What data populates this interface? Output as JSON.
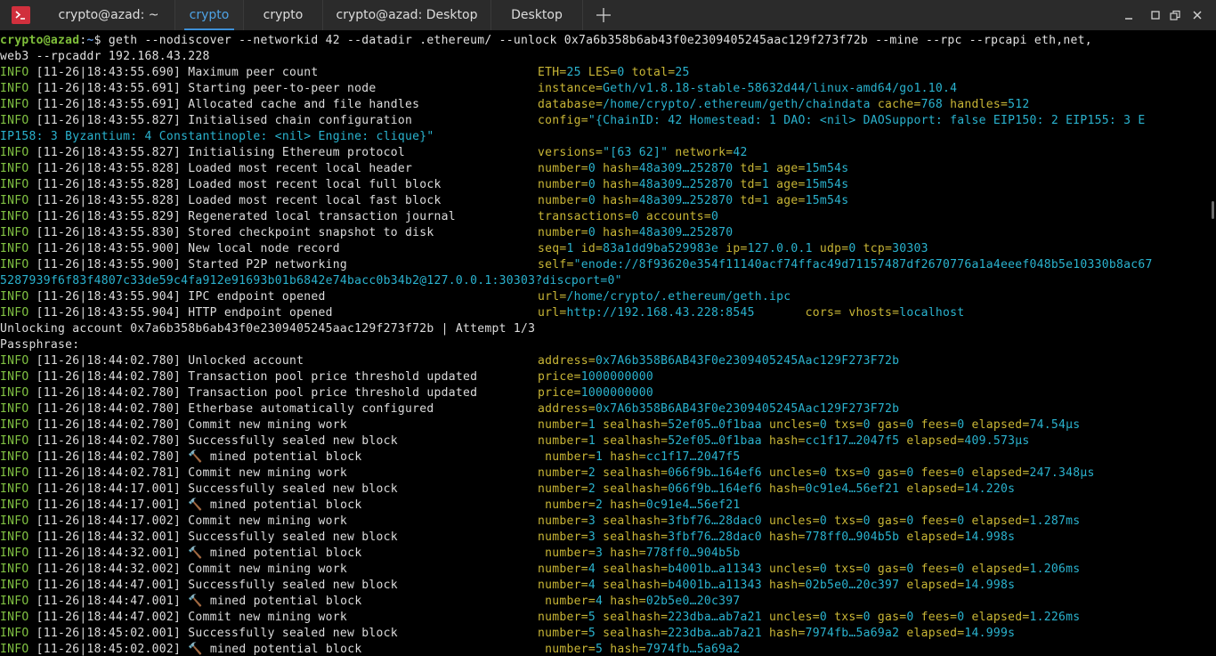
{
  "tabbar": {
    "tabs": [
      {
        "label": "crypto@azad: ~",
        "active": false
      },
      {
        "label": "crypto",
        "active": true
      },
      {
        "label": "crypto",
        "active": false
      },
      {
        "label": "crypto@azad: Desktop",
        "active": false
      },
      {
        "label": "Desktop",
        "active": false
      }
    ],
    "new_tab_icon": "plus-icon",
    "window_controls": [
      "minimize-icon",
      "maximize-icon",
      "close-icon"
    ]
  },
  "colors": {
    "info": "#80c142",
    "value_key": "#c9b636",
    "value": "#2ab3cf",
    "prompt_user": "#7fbf3a",
    "prompt_path": "#5c8fd6",
    "accent_tab": "#4ea3e6",
    "app_icon": "#d1303d"
  },
  "terminal": {
    "prompt": {
      "user": "crypto@azad",
      "sep": ":",
      "path": "~",
      "symbol": "$ ",
      "command_line1": "geth --nodiscover --networkid 42 --datadir .ethereum/ --unlock 0x7a6b358b6ab43f0e2309405245aac129f273f72b --mine --rpc --rpcapi eth,net,",
      "command_line2": "web3 --rpcaddr 192.168.43.228"
    },
    "log": [
      {
        "level": "INFO",
        "time": "[11-26|18:43:55.690]",
        "msg": "Maximum peer count",
        "ctx": [
          {
            "k": "ETH",
            "v": "25"
          },
          {
            "k": "LES",
            "v": "0"
          },
          {
            "k": "total",
            "v": "25"
          }
        ]
      },
      {
        "level": "INFO",
        "time": "[11-26|18:43:55.691]",
        "msg": "Starting peer-to-peer node",
        "ctx": [
          {
            "k": "instance",
            "v": "Geth/v1.8.18-stable-58632d44/linux-amd64/go1.10.4"
          }
        ]
      },
      {
        "level": "INFO",
        "time": "[11-26|18:43:55.691]",
        "msg": "Allocated cache and file handles",
        "ctx": [
          {
            "k": "database",
            "v": "/home/crypto/.ethereum/geth/chaindata"
          },
          {
            "k": "cache",
            "v": "768"
          },
          {
            "k": "handles",
            "v": "512"
          }
        ]
      },
      {
        "level": "INFO",
        "time": "[11-26|18:43:55.827]",
        "msg": "Initialised chain configuration",
        "ctx": [
          {
            "k": "config",
            "v": "\"{ChainID: 42 Homestead: 1 DAO: <nil> DAOSupport: false EIP150: 2 EIP155: 3 E"
          }
        ]
      },
      {
        "wrap": "IP158: 3 Byzantium: 4 Constantinople: <nil> Engine: clique}\""
      },
      {
        "level": "INFO",
        "time": "[11-26|18:43:55.827]",
        "msg": "Initialising Ethereum protocol",
        "ctx": [
          {
            "k": "versions",
            "v": "\"[63 62]\""
          },
          {
            "k": "network",
            "v": "42"
          }
        ]
      },
      {
        "level": "INFO",
        "time": "[11-26|18:43:55.828]",
        "msg": "Loaded most recent local header",
        "ctx": [
          {
            "k": "number",
            "v": "0"
          },
          {
            "k": "hash",
            "v": "48a309…252870"
          },
          {
            "k": "td",
            "v": "1"
          },
          {
            "k": "age",
            "v": "15m54s"
          }
        ]
      },
      {
        "level": "INFO",
        "time": "[11-26|18:43:55.828]",
        "msg": "Loaded most recent local full block",
        "ctx": [
          {
            "k": "number",
            "v": "0"
          },
          {
            "k": "hash",
            "v": "48a309…252870"
          },
          {
            "k": "td",
            "v": "1"
          },
          {
            "k": "age",
            "v": "15m54s"
          }
        ]
      },
      {
        "level": "INFO",
        "time": "[11-26|18:43:55.828]",
        "msg": "Loaded most recent local fast block",
        "ctx": [
          {
            "k": "number",
            "v": "0"
          },
          {
            "k": "hash",
            "v": "48a309…252870"
          },
          {
            "k": "td",
            "v": "1"
          },
          {
            "k": "age",
            "v": "15m54s"
          }
        ]
      },
      {
        "level": "INFO",
        "time": "[11-26|18:43:55.829]",
        "msg": "Regenerated local transaction journal",
        "ctx": [
          {
            "k": "transactions",
            "v": "0"
          },
          {
            "k": "accounts",
            "v": "0"
          }
        ]
      },
      {
        "level": "INFO",
        "time": "[11-26|18:43:55.830]",
        "msg": "Stored checkpoint snapshot to disk",
        "ctx": [
          {
            "k": "number",
            "v": "0"
          },
          {
            "k": "hash",
            "v": "48a309…252870"
          }
        ]
      },
      {
        "level": "INFO",
        "time": "[11-26|18:43:55.900]",
        "msg": "New local node record",
        "ctx": [
          {
            "k": "seq",
            "v": "1"
          },
          {
            "k": "id",
            "v": "83a1dd9ba529983e"
          },
          {
            "k": "ip",
            "v": "127.0.0.1"
          },
          {
            "k": "udp",
            "v": "0"
          },
          {
            "k": "tcp",
            "v": "30303"
          }
        ]
      },
      {
        "level": "INFO",
        "time": "[11-26|18:43:55.900]",
        "msg": "Started P2P networking",
        "ctx": [
          {
            "k": "self",
            "v": "\"enode://8f93620e354f11140acf74ffac49d71157487df2670776a1a4eeef048b5e10330b8ac67"
          }
        ]
      },
      {
        "wrap": "5287939f6f83f4807c33de59c4fa912e91693b01b6842e74bacc0b34b2@127.0.0.1:30303?discport=0\""
      },
      {
        "level": "INFO",
        "time": "[11-26|18:43:55.904]",
        "msg": "IPC endpoint opened",
        "ctx": [
          {
            "k": "url",
            "v": "/home/crypto/.ethereum/geth.ipc"
          }
        ]
      },
      {
        "level": "INFO",
        "time": "[11-26|18:43:55.904]",
        "msg": "HTTP endpoint opened",
        "ctx": [
          {
            "k": "url",
            "v": "http://192.168.43.228:8545      "
          },
          {
            "k": "cors",
            "v": ""
          },
          {
            "k": "vhosts",
            "v": "localhost"
          }
        ]
      },
      {
        "plain": "Unlocking account 0x7a6b358b6ab43f0e2309405245aac129f273f72b | Attempt 1/3"
      },
      {
        "plain": "Passphrase:"
      },
      {
        "level": "INFO",
        "time": "[11-26|18:44:02.780]",
        "msg": "Unlocked account",
        "ctx": [
          {
            "k": "address",
            "v": "0x7A6b358B6AB43F0e2309405245Aac129F273F72b"
          }
        ]
      },
      {
        "level": "INFO",
        "time": "[11-26|18:44:02.780]",
        "msg": "Transaction pool price threshold updated",
        "ctx": [
          {
            "k": "price",
            "v": "1000000000"
          }
        ]
      },
      {
        "level": "INFO",
        "time": "[11-26|18:44:02.780]",
        "msg": "Transaction pool price threshold updated",
        "ctx": [
          {
            "k": "price",
            "v": "1000000000"
          }
        ]
      },
      {
        "level": "INFO",
        "time": "[11-26|18:44:02.780]",
        "msg": "Etherbase automatically configured",
        "ctx": [
          {
            "k": "address",
            "v": "0x7A6b358B6AB43F0e2309405245Aac129F273F72b"
          }
        ]
      },
      {
        "level": "INFO",
        "time": "[11-26|18:44:02.780]",
        "msg": "Commit new mining work",
        "ctx": [
          {
            "k": "number",
            "v": "1"
          },
          {
            "k": "sealhash",
            "v": "52ef05…0f1baa"
          },
          {
            "k": "uncles",
            "v": "0"
          },
          {
            "k": "txs",
            "v": "0"
          },
          {
            "k": "gas",
            "v": "0"
          },
          {
            "k": "fees",
            "v": "0"
          },
          {
            "k": "elapsed",
            "v": "74.54µs"
          }
        ]
      },
      {
        "level": "INFO",
        "time": "[11-26|18:44:02.780]",
        "msg": "Successfully sealed new block",
        "ctx": [
          {
            "k": "number",
            "v": "1"
          },
          {
            "k": "sealhash",
            "v": "52ef05…0f1baa"
          },
          {
            "k": "hash",
            "v": "cc1f17…2047f5"
          },
          {
            "k": "elapsed",
            "v": "409.573µs"
          }
        ]
      },
      {
        "level": "INFO",
        "time": "[11-26|18:44:02.780]",
        "msg": "🔨 mined potential block",
        "ctx_pad": " ",
        "ctx": [
          {
            "k": "number",
            "v": "1"
          },
          {
            "k": "hash",
            "v": "cc1f17…2047f5"
          }
        ]
      },
      {
        "level": "INFO",
        "time": "[11-26|18:44:02.781]",
        "msg": "Commit new mining work",
        "ctx": [
          {
            "k": "number",
            "v": "2"
          },
          {
            "k": "sealhash",
            "v": "066f9b…164ef6"
          },
          {
            "k": "uncles",
            "v": "0"
          },
          {
            "k": "txs",
            "v": "0"
          },
          {
            "k": "gas",
            "v": "0"
          },
          {
            "k": "fees",
            "v": "0"
          },
          {
            "k": "elapsed",
            "v": "247.348µs"
          }
        ]
      },
      {
        "level": "INFO",
        "time": "[11-26|18:44:17.001]",
        "msg": "Successfully sealed new block",
        "ctx": [
          {
            "k": "number",
            "v": "2"
          },
          {
            "k": "sealhash",
            "v": "066f9b…164ef6"
          },
          {
            "k": "hash",
            "v": "0c91e4…56ef21"
          },
          {
            "k": "elapsed",
            "v": "14.220s"
          }
        ]
      },
      {
        "level": "INFO",
        "time": "[11-26|18:44:17.001]",
        "msg": "🔨 mined potential block",
        "ctx_pad": " ",
        "ctx": [
          {
            "k": "number",
            "v": "2"
          },
          {
            "k": "hash",
            "v": "0c91e4…56ef21"
          }
        ]
      },
      {
        "level": "INFO",
        "time": "[11-26|18:44:17.002]",
        "msg": "Commit new mining work",
        "ctx": [
          {
            "k": "number",
            "v": "3"
          },
          {
            "k": "sealhash",
            "v": "3fbf76…28dac0"
          },
          {
            "k": "uncles",
            "v": "0"
          },
          {
            "k": "txs",
            "v": "0"
          },
          {
            "k": "gas",
            "v": "0"
          },
          {
            "k": "fees",
            "v": "0"
          },
          {
            "k": "elapsed",
            "v": "1.287ms"
          }
        ]
      },
      {
        "level": "INFO",
        "time": "[11-26|18:44:32.001]",
        "msg": "Successfully sealed new block",
        "ctx": [
          {
            "k": "number",
            "v": "3"
          },
          {
            "k": "sealhash",
            "v": "3fbf76…28dac0"
          },
          {
            "k": "hash",
            "v": "778ff0…904b5b"
          },
          {
            "k": "elapsed",
            "v": "14.998s"
          }
        ]
      },
      {
        "level": "INFO",
        "time": "[11-26|18:44:32.001]",
        "msg": "🔨 mined potential block",
        "ctx_pad": " ",
        "ctx": [
          {
            "k": "number",
            "v": "3"
          },
          {
            "k": "hash",
            "v": "778ff0…904b5b"
          }
        ]
      },
      {
        "level": "INFO",
        "time": "[11-26|18:44:32.002]",
        "msg": "Commit new mining work",
        "ctx": [
          {
            "k": "number",
            "v": "4"
          },
          {
            "k": "sealhash",
            "v": "b4001b…a11343"
          },
          {
            "k": "uncles",
            "v": "0"
          },
          {
            "k": "txs",
            "v": "0"
          },
          {
            "k": "gas",
            "v": "0"
          },
          {
            "k": "fees",
            "v": "0"
          },
          {
            "k": "elapsed",
            "v": "1.206ms"
          }
        ]
      },
      {
        "level": "INFO",
        "time": "[11-26|18:44:47.001]",
        "msg": "Successfully sealed new block",
        "ctx": [
          {
            "k": "number",
            "v": "4"
          },
          {
            "k": "sealhash",
            "v": "b4001b…a11343"
          },
          {
            "k": "hash",
            "v": "02b5e0…20c397"
          },
          {
            "k": "elapsed",
            "v": "14.998s"
          }
        ]
      },
      {
        "level": "INFO",
        "time": "[11-26|18:44:47.001]",
        "msg": "🔨 mined potential block",
        "ctx_pad": " ",
        "ctx": [
          {
            "k": "number",
            "v": "4"
          },
          {
            "k": "hash",
            "v": "02b5e0…20c397"
          }
        ]
      },
      {
        "level": "INFO",
        "time": "[11-26|18:44:47.002]",
        "msg": "Commit new mining work",
        "ctx": [
          {
            "k": "number",
            "v": "5"
          },
          {
            "k": "sealhash",
            "v": "223dba…ab7a21"
          },
          {
            "k": "uncles",
            "v": "0"
          },
          {
            "k": "txs",
            "v": "0"
          },
          {
            "k": "gas",
            "v": "0"
          },
          {
            "k": "fees",
            "v": "0"
          },
          {
            "k": "elapsed",
            "v": "1.226ms"
          }
        ]
      },
      {
        "level": "INFO",
        "time": "[11-26|18:45:02.001]",
        "msg": "Successfully sealed new block",
        "ctx": [
          {
            "k": "number",
            "v": "5"
          },
          {
            "k": "sealhash",
            "v": "223dba…ab7a21"
          },
          {
            "k": "hash",
            "v": "7974fb…5a69a2"
          },
          {
            "k": "elapsed",
            "v": "14.999s"
          }
        ]
      },
      {
        "level": "INFO",
        "time": "[11-26|18:45:02.002]",
        "msg": "🔨 mined potential block",
        "ctx_pad": " ",
        "ctx": [
          {
            "k": "number",
            "v": "5"
          },
          {
            "k": "hash",
            "v": "7974fb…5a69a2"
          }
        ]
      }
    ]
  }
}
